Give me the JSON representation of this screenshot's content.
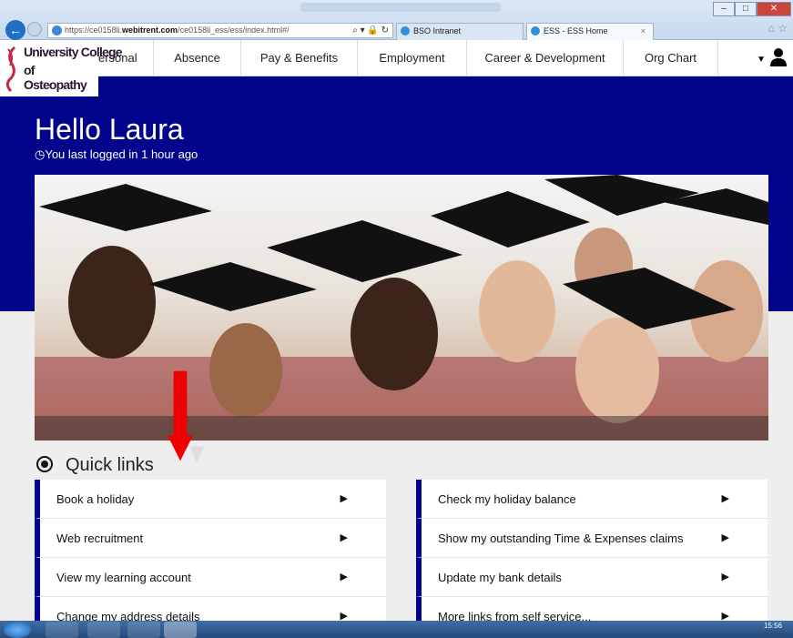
{
  "browser": {
    "url_prefix": "https://ce0158li.",
    "url_domain": "webitrent.com",
    "url_path": "/ce0158li_ess/ess/index.html#/",
    "tabs": [
      {
        "label": "BSO Intranet"
      },
      {
        "label": "ESS - ESS Home"
      }
    ]
  },
  "logo": {
    "line1": "University College",
    "line2": "of Osteopathy"
  },
  "nav": {
    "items": [
      {
        "label": "ersonal"
      },
      {
        "label": "Absence"
      },
      {
        "label": "Pay & Benefits"
      },
      {
        "label": "Employment"
      },
      {
        "label": "Career & Development"
      },
      {
        "label": "Org Chart"
      }
    ]
  },
  "hero": {
    "greeting": "Hello Laura",
    "last_login": "You last logged in 1 hour ago"
  },
  "quick_links": {
    "title": "Quick links",
    "left": [
      {
        "label": "Book a holiday"
      },
      {
        "label": "Web recruitment"
      },
      {
        "label": "View my learning account"
      },
      {
        "label": "Change my address details"
      }
    ],
    "right": [
      {
        "label": "Check my holiday balance"
      },
      {
        "label": "Show my outstanding Time & Expenses claims"
      },
      {
        "label": "Update my bank details"
      },
      {
        "label": "More links from self service..."
      }
    ]
  },
  "taskbar": {
    "time": "15:56"
  },
  "colors": {
    "brand_blue": "#02048c",
    "annotation_red": "#ee0000"
  }
}
